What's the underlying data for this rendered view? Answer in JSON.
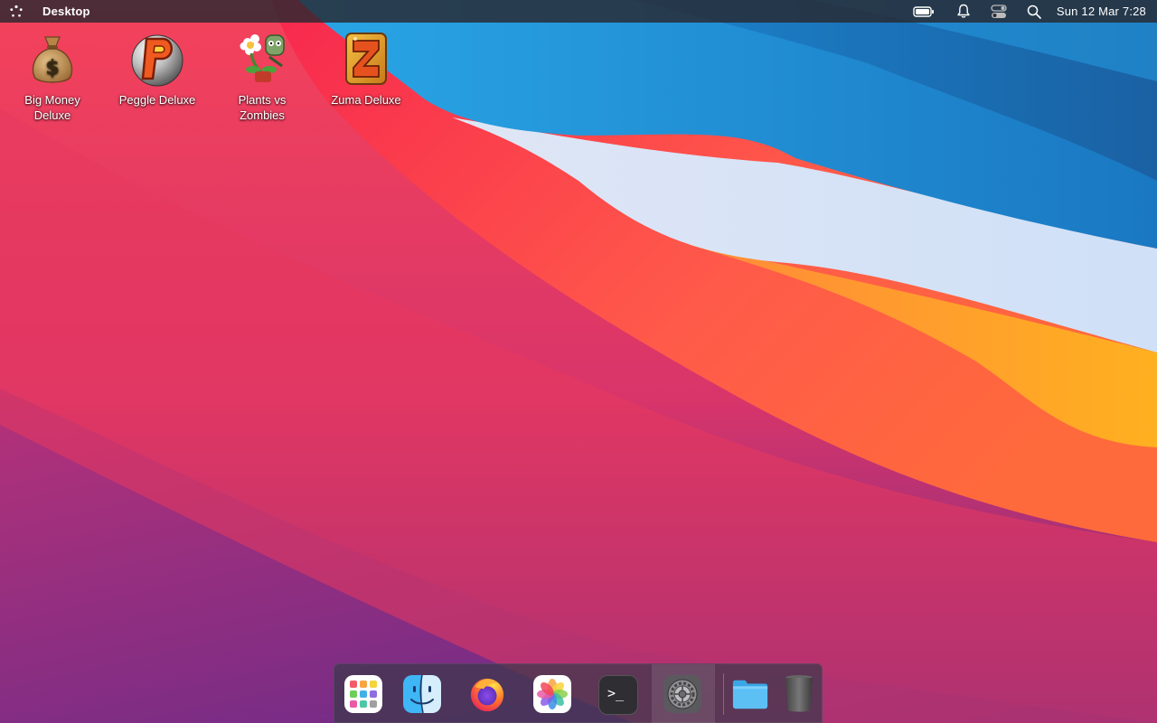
{
  "topbar": {
    "launcher_icon": "apps-dots-icon",
    "title": "Desktop",
    "status_icons": [
      "battery-icon",
      "bell-icon",
      "toggle-icon",
      "search-icon"
    ],
    "clock": "Sun 12 Mar 7:28"
  },
  "desktop_icons": [
    {
      "label": "Big Money Deluxe",
      "icon": "money-bag-icon"
    },
    {
      "label": "Peggle Deluxe",
      "icon": "peggle-icon"
    },
    {
      "label": "Plants vs Zombies",
      "icon": "plants-vs-zombies-icon"
    },
    {
      "label": "Zuma Deluxe",
      "icon": "zuma-icon"
    }
  ],
  "dock": {
    "items": [
      {
        "name": "launchpad",
        "icon": "launchpad-icon"
      },
      {
        "name": "finder",
        "icon": "finder-icon"
      },
      {
        "name": "firefox",
        "icon": "firefox-icon"
      },
      {
        "name": "photos",
        "icon": "photos-icon"
      },
      {
        "name": "terminal",
        "icon": "terminal-icon",
        "glyph": ">_"
      },
      {
        "name": "system-settings",
        "icon": "settings-gear-icon"
      },
      {
        "name": "files",
        "icon": "folder-icon"
      },
      {
        "name": "trash",
        "icon": "trash-icon"
      }
    ]
  },
  "colors": {
    "topbar_bg": "#2a2a30",
    "accent_red": "#f23a4f",
    "accent_orange": "#f7a21d",
    "accent_blue": "#1e88d8"
  }
}
